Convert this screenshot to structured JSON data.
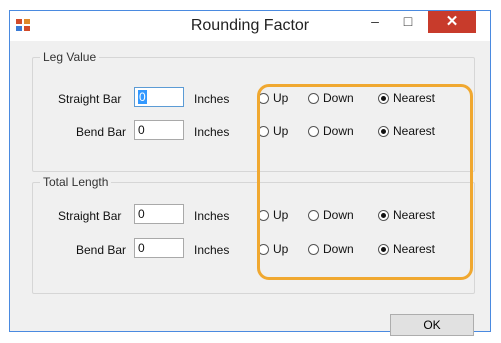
{
  "window": {
    "title": "Rounding Factor",
    "minimize_glyph": "–",
    "maximize_glyph": "□",
    "close_glyph": "✕"
  },
  "leg_value": {
    "title": "Leg Value",
    "rows": [
      {
        "label": "Straight Bar",
        "value": "0",
        "unit": "Inches",
        "options": [
          "Up",
          "Down",
          "Nearest"
        ],
        "selected": "Nearest"
      },
      {
        "label": "Bend Bar",
        "value": "0",
        "unit": "Inches",
        "options": [
          "Up",
          "Down",
          "Nearest"
        ],
        "selected": "Nearest"
      }
    ]
  },
  "total_length": {
    "title": "Total Length",
    "rows": [
      {
        "label": "Straight Bar",
        "value": "0",
        "unit": "Inches",
        "options": [
          "Up",
          "Down",
          "Nearest"
        ],
        "selected": "Nearest"
      },
      {
        "label": "Bend Bar",
        "value": "0",
        "unit": "Inches",
        "options": [
          "Up",
          "Down",
          "Nearest"
        ],
        "selected": "Nearest"
      }
    ]
  },
  "ok_label": "OK",
  "colors": {
    "highlight": "#f0a830",
    "close_button": "#c83b2b",
    "window_border": "#4a8ae0"
  }
}
